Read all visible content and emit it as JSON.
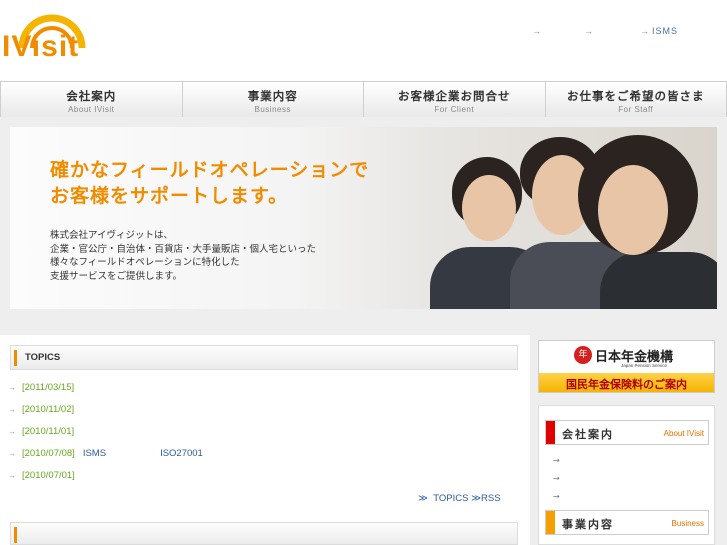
{
  "header": {
    "logo_text": "IVisit",
    "top_links": [
      {
        "label": ""
      },
      {
        "label": ""
      },
      {
        "label": "ISMS"
      }
    ]
  },
  "nav": [
    {
      "jp": "会社案内",
      "en": "About IVisit"
    },
    {
      "jp": "事業内容",
      "en": "Business"
    },
    {
      "jp": "お客様企業お問合せ",
      "en": "For Client"
    },
    {
      "jp": "お仕事をご希望の皆さま",
      "en": "For Staff"
    }
  ],
  "hero": {
    "headline_1": "確かなフィールドオペレーションで",
    "headline_2": "お客様をサポートします。",
    "body_1": "株式会社アイヴィジットは、",
    "body_2": "企業・官公庁・自治体・百貨店・大手量販店・個人宅といった",
    "body_3": "様々なフィールドオペレーションに特化した",
    "body_4": "支援サービスをご提供します。"
  },
  "topics": {
    "title": "TOPICS",
    "items": [
      {
        "date": "[2011/03/15]",
        "text": "",
        "text2": ""
      },
      {
        "date": "[2010/11/02]",
        "text": "",
        "text2": ""
      },
      {
        "date": "[2010/11/01]",
        "text": "",
        "text2": ""
      },
      {
        "date": "[2010/07/08]",
        "text": "ISMS",
        "text2": "ISO27001"
      },
      {
        "date": "[2010/07/01]",
        "text": "",
        "text2": ""
      }
    ],
    "more_prefix": "≫",
    "more_label": "TOPICS",
    "rss_label": "≫RSS"
  },
  "sidebar": {
    "pension_mark": "年",
    "pension_name": "日本年金機構",
    "pension_en": "Japan Pension Service",
    "pension_sub": "国民年金保険料のご案内",
    "sections": [
      {
        "jp": "会社案内",
        "en": "About IVisit",
        "color": "#e00000"
      },
      {
        "jp": "事業内容",
        "en": "Business",
        "color": "#f5a000"
      }
    ]
  },
  "colors": {
    "accent": "#f08c00",
    "link": "#2c5aa0",
    "date": "#66a61e"
  }
}
